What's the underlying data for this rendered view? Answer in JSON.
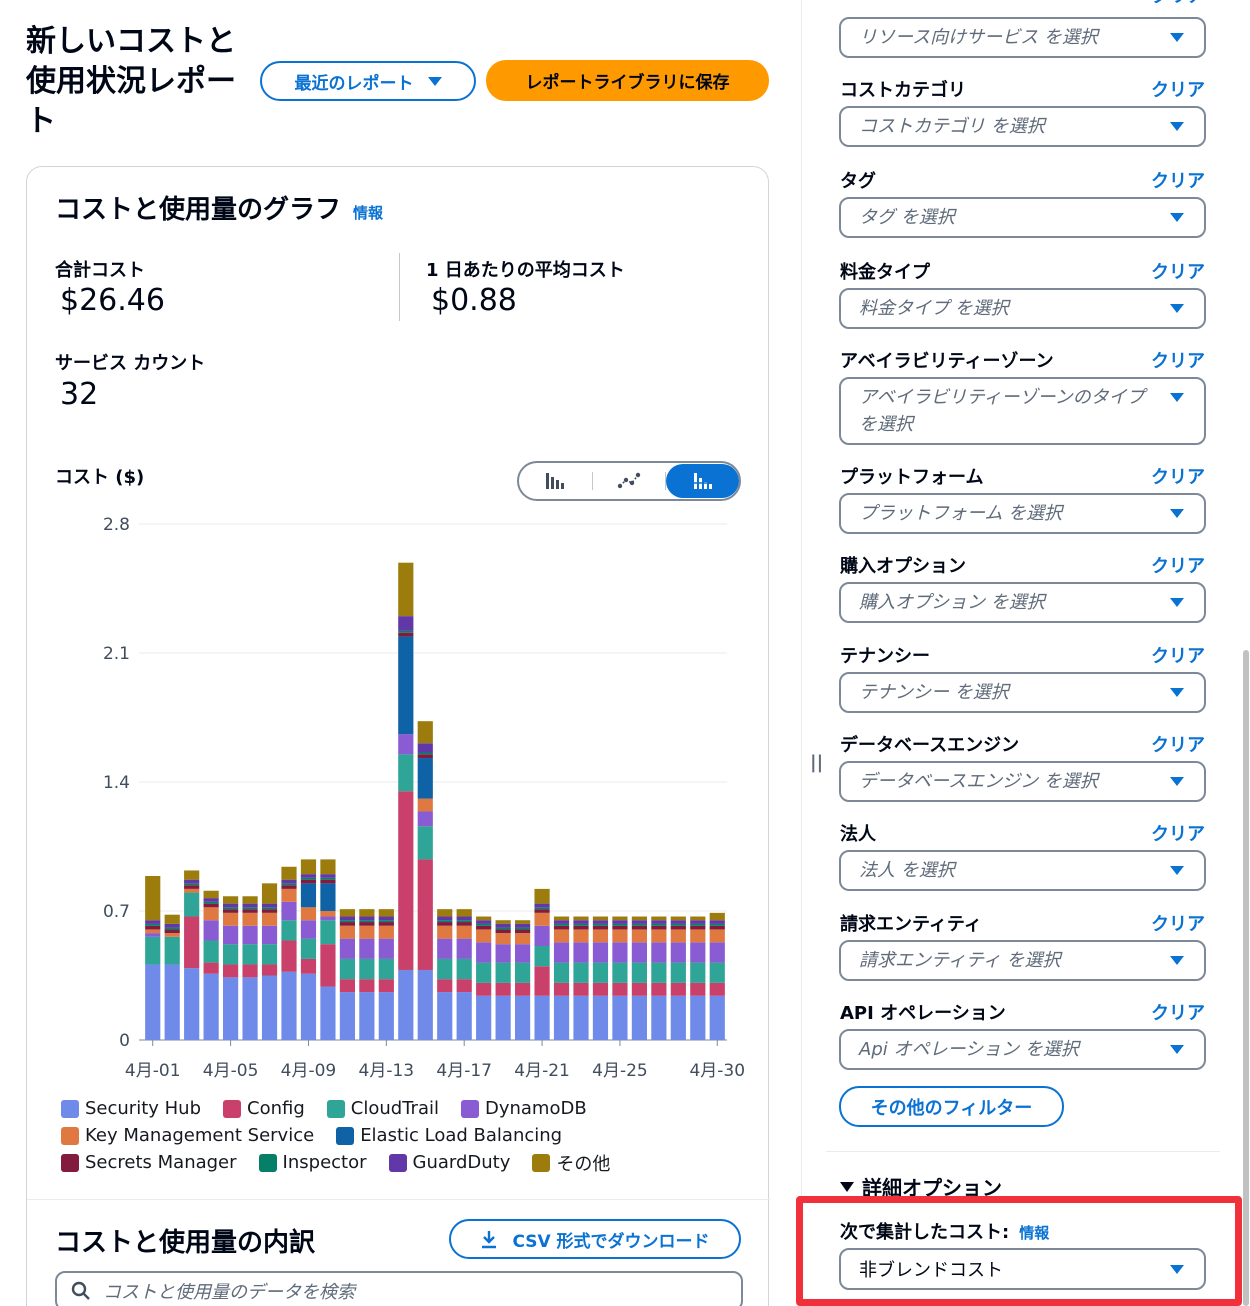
{
  "header": {
    "title": "新しいコストと使用状況レポート",
    "recent_reports_label": "最近のレポート",
    "save_label": "レポートライブラリに保存"
  },
  "graph": {
    "title": "コストと使用量のグラフ",
    "info_label": "情報",
    "total_cost_label": "合計コスト",
    "total_cost_value": "$26.46",
    "avg_cost_label": "1 日あたりの平均コスト",
    "avg_cost_value": "$0.88",
    "service_count_label": "サービス カウント",
    "service_count_value": "32",
    "y_axis_title": "コスト ($)",
    "chart_type_options": [
      "bar-icon",
      "line-icon",
      "stacked-bar-icon"
    ],
    "chart_type_selected": "stacked-bar-icon"
  },
  "chart_data": {
    "type": "bar",
    "stacked": true,
    "ylim": [
      0,
      2.8
    ],
    "yticks": [
      "0",
      "0.7",
      "1.4",
      "2.1",
      "2.8"
    ],
    "categories": [
      "4月-01",
      "4月-02",
      "4月-03",
      "4月-04",
      "4月-05",
      "4月-06",
      "4月-07",
      "4月-08",
      "4月-09",
      "4月-10",
      "4月-11",
      "4月-12",
      "4月-13",
      "4月-14",
      "4月-15",
      "4月-16",
      "4月-17",
      "4月-18",
      "4月-19",
      "4月-20",
      "4月-21",
      "4月-22",
      "4月-23",
      "4月-24",
      "4月-25",
      "4月-26",
      "4月-27",
      "4月-28",
      "4月-29",
      "4月-30"
    ],
    "xtick_labels": [
      "4月-01",
      "4月-05",
      "4月-09",
      "4月-13",
      "4月-17",
      "4月-21",
      "4月-25",
      "4月-30"
    ],
    "grid": true,
    "legend_position": "bottom",
    "series": [
      {
        "name": "Security Hub",
        "color": "#6f8ae8",
        "values": [
          0.41,
          0.41,
          0.39,
          0.36,
          0.34,
          0.34,
          0.35,
          0.37,
          0.36,
          0.29,
          0.26,
          0.26,
          0.26,
          0.38,
          0.38,
          0.26,
          0.26,
          0.24,
          0.24,
          0.24,
          0.24,
          0.24,
          0.24,
          0.24,
          0.24,
          0.24,
          0.24,
          0.24,
          0.24,
          0.24
        ]
      },
      {
        "name": "Config",
        "color": "#c9406a",
        "values": [
          0.0,
          0.0,
          0.28,
          0.06,
          0.07,
          0.07,
          0.06,
          0.17,
          0.08,
          0.23,
          0.07,
          0.07,
          0.07,
          0.97,
          0.6,
          0.07,
          0.07,
          0.07,
          0.07,
          0.07,
          0.16,
          0.07,
          0.07,
          0.07,
          0.07,
          0.07,
          0.07,
          0.07,
          0.07,
          0.07
        ]
      },
      {
        "name": "CloudTrail",
        "color": "#2ea597",
        "values": [
          0.15,
          0.15,
          0.13,
          0.12,
          0.11,
          0.11,
          0.11,
          0.11,
          0.11,
          0.13,
          0.11,
          0.11,
          0.11,
          0.2,
          0.18,
          0.11,
          0.11,
          0.11,
          0.11,
          0.11,
          0.11,
          0.11,
          0.11,
          0.11,
          0.11,
          0.11,
          0.11,
          0.11,
          0.11,
          0.11
        ]
      },
      {
        "name": "DynamoDB",
        "color": "#8a5cd4",
        "values": [
          0.02,
          0.0,
          0.0,
          0.11,
          0.1,
          0.1,
          0.1,
          0.1,
          0.1,
          0.02,
          0.11,
          0.11,
          0.11,
          0.11,
          0.08,
          0.11,
          0.11,
          0.11,
          0.1,
          0.1,
          0.11,
          0.11,
          0.11,
          0.11,
          0.11,
          0.11,
          0.11,
          0.11,
          0.11,
          0.11
        ]
      },
      {
        "name": "Key Management Service",
        "color": "#e07941",
        "values": [
          0.02,
          0.02,
          0.02,
          0.07,
          0.07,
          0.07,
          0.07,
          0.07,
          0.07,
          0.03,
          0.07,
          0.07,
          0.07,
          0.0,
          0.07,
          0.07,
          0.07,
          0.07,
          0.06,
          0.06,
          0.07,
          0.07,
          0.07,
          0.07,
          0.07,
          0.07,
          0.07,
          0.07,
          0.07,
          0.07
        ]
      },
      {
        "name": "Elastic Load Balancing",
        "color": "#0f62a5",
        "values": [
          0,
          0,
          0,
          0,
          0,
          0,
          0,
          0,
          0.13,
          0.15,
          0,
          0,
          0,
          0.53,
          0.22,
          0,
          0,
          0,
          0,
          0,
          0,
          0,
          0,
          0,
          0,
          0,
          0,
          0,
          0,
          0
        ]
      },
      {
        "name": "Secrets Manager",
        "color": "#821b3d",
        "values": [
          0.02,
          0.02,
          0.02,
          0.02,
          0.02,
          0.02,
          0.02,
          0.02,
          0.02,
          0.02,
          0.02,
          0.02,
          0.02,
          0.02,
          0.02,
          0.02,
          0.02,
          0.02,
          0.02,
          0.02,
          0.02,
          0.02,
          0.02,
          0.02,
          0.02,
          0.02,
          0.02,
          0.02,
          0.02,
          0.02
        ]
      },
      {
        "name": "Inspector",
        "color": "#067f68",
        "values": [
          0.01,
          0.01,
          0.01,
          0.01,
          0.01,
          0.01,
          0.01,
          0.01,
          0.01,
          0.01,
          0.01,
          0.01,
          0.01,
          0.01,
          0.01,
          0.01,
          0.01,
          0.01,
          0.01,
          0.01,
          0.01,
          0.01,
          0.01,
          0.01,
          0.01,
          0.01,
          0.01,
          0.01,
          0.01,
          0.01
        ]
      },
      {
        "name": "GuardDuty",
        "color": "#6237a8",
        "values": [
          0.02,
          0.02,
          0.02,
          0.02,
          0.02,
          0.02,
          0.02,
          0.02,
          0.02,
          0.02,
          0.02,
          0.02,
          0.02,
          0.08,
          0.05,
          0.02,
          0.02,
          0.02,
          0.02,
          0.02,
          0.02,
          0.02,
          0.02,
          0.02,
          0.02,
          0.02,
          0.02,
          0.02,
          0.02,
          0.02
        ]
      },
      {
        "name": "その他",
        "color": "#9c7c0c",
        "values": [
          0.24,
          0.05,
          0.05,
          0.04,
          0.04,
          0.04,
          0.11,
          0.07,
          0.08,
          0.08,
          0.04,
          0.04,
          0.04,
          0.29,
          0.12,
          0.04,
          0.04,
          0.02,
          0.02,
          0.02,
          0.08,
          0.02,
          0.02,
          0.02,
          0.02,
          0.02,
          0.02,
          0.02,
          0.02,
          0.04
        ]
      }
    ]
  },
  "breakdown": {
    "title": "コストと使用量の内訳",
    "download_label": "CSV 形式でダウンロード",
    "search_placeholder": "コストと使用量のデータを検索"
  },
  "filters": {
    "clear_label": "クリア",
    "items": [
      {
        "label": "",
        "placeholder": "リソース向けサービス を選択"
      },
      {
        "label": "コストカテゴリ",
        "placeholder": "コストカテゴリ を選択"
      },
      {
        "label": "タグ",
        "placeholder": "タグ を選択"
      },
      {
        "label": "料金タイプ",
        "placeholder": "料金タイプ を選択"
      },
      {
        "label": "アベイラビリティーゾーン",
        "placeholder": "アベイラビリティーゾーンのタイプ を選択"
      },
      {
        "label": "プラットフォーム",
        "placeholder": "プラットフォーム を選択"
      },
      {
        "label": "購入オプション",
        "placeholder": "購入オプション を選択"
      },
      {
        "label": "テナンシー",
        "placeholder": "テナンシー を選択"
      },
      {
        "label": "データベースエンジン",
        "placeholder": "データベースエンジン を選択"
      },
      {
        "label": "法人",
        "placeholder": "法人 を選択"
      },
      {
        "label": "請求エンティティ",
        "placeholder": "請求エンティティ を選択"
      },
      {
        "label": "API オペレーション",
        "placeholder": "Api オペレーション を選択"
      }
    ],
    "more_filters_label": "その他のフィルター"
  },
  "advanced": {
    "title": "詳細オプション",
    "aggregate_label": "次で集計したコスト:",
    "info_label": "情報",
    "aggregate_value": "非ブレンドコスト"
  },
  "colors": {
    "accent": "#0972d3",
    "primary_button": "#ff9900",
    "highlight": "#f0303b"
  }
}
